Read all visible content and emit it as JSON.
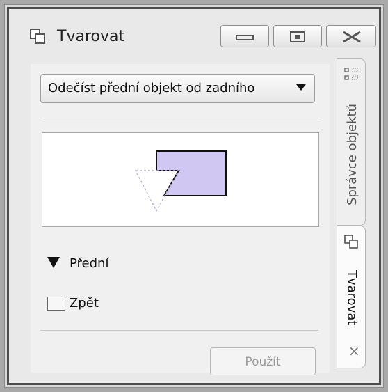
{
  "window": {
    "title": "Tvarovat",
    "buttons": {
      "minimize": "minimize",
      "maximize": "maximize",
      "close": "close"
    }
  },
  "shape_panel": {
    "operation_select": {
      "value": "Odečíst přední objekt od zadního"
    },
    "legend": {
      "front": "Přední",
      "back": "Zpět"
    },
    "apply_label": "Použít"
  },
  "side_tabs": {
    "object_manager": "Správce objektů",
    "shape": "Tvarovat",
    "close": "×"
  },
  "icons": {
    "app": "shape-icon",
    "object_manager": "object-manager-icon",
    "shape_tab": "shape-icon",
    "combo_arrow": "chevron-down-icon",
    "front_marker": "front-triangle-icon",
    "back_marker": "back-rectangle-icon"
  },
  "colors": {
    "preview_fill": "#d0c8f3",
    "preview_dashed": "#b9b1d8",
    "window_border": "#4d4d4d"
  }
}
